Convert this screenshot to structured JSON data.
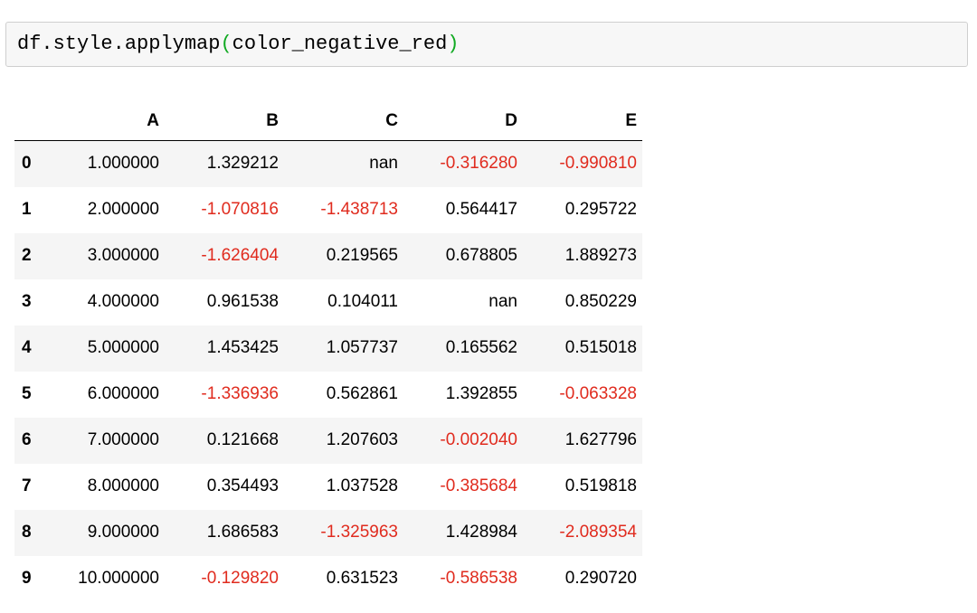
{
  "code": {
    "prefix": "df.style.applymap",
    "open_paren": "(",
    "argument": "color_negative_red",
    "close_paren": ")"
  },
  "colors": {
    "negative": "#e02b1e",
    "paren": "#11aa22",
    "striped_row": "#f5f5f5"
  },
  "table": {
    "columns": [
      "",
      "A",
      "B",
      "C",
      "D",
      "E"
    ],
    "rows": [
      {
        "index": "0",
        "A": "1.000000",
        "B": "1.329212",
        "C": "nan",
        "D": "-0.316280",
        "E": "-0.990810"
      },
      {
        "index": "1",
        "A": "2.000000",
        "B": "-1.070816",
        "C": "-1.438713",
        "D": "0.564417",
        "E": "0.295722"
      },
      {
        "index": "2",
        "A": "3.000000",
        "B": "-1.626404",
        "C": "0.219565",
        "D": "0.678805",
        "E": "1.889273"
      },
      {
        "index": "3",
        "A": "4.000000",
        "B": "0.961538",
        "C": "0.104011",
        "D": "nan",
        "E": "0.850229"
      },
      {
        "index": "4",
        "A": "5.000000",
        "B": "1.453425",
        "C": "1.057737",
        "D": "0.165562",
        "E": "0.515018"
      },
      {
        "index": "5",
        "A": "6.000000",
        "B": "-1.336936",
        "C": "0.562861",
        "D": "1.392855",
        "E": "-0.063328"
      },
      {
        "index": "6",
        "A": "7.000000",
        "B": "0.121668",
        "C": "1.207603",
        "D": "-0.002040",
        "E": "1.627796"
      },
      {
        "index": "7",
        "A": "8.000000",
        "B": "0.354493",
        "C": "1.037528",
        "D": "-0.385684",
        "E": "0.519818"
      },
      {
        "index": "8",
        "A": "9.000000",
        "B": "1.686583",
        "C": "-1.325963",
        "D": "1.428984",
        "E": "-2.089354"
      },
      {
        "index": "9",
        "A": "10.000000",
        "B": "-0.129820",
        "C": "0.631523",
        "D": "-0.586538",
        "E": "0.290720"
      }
    ]
  }
}
